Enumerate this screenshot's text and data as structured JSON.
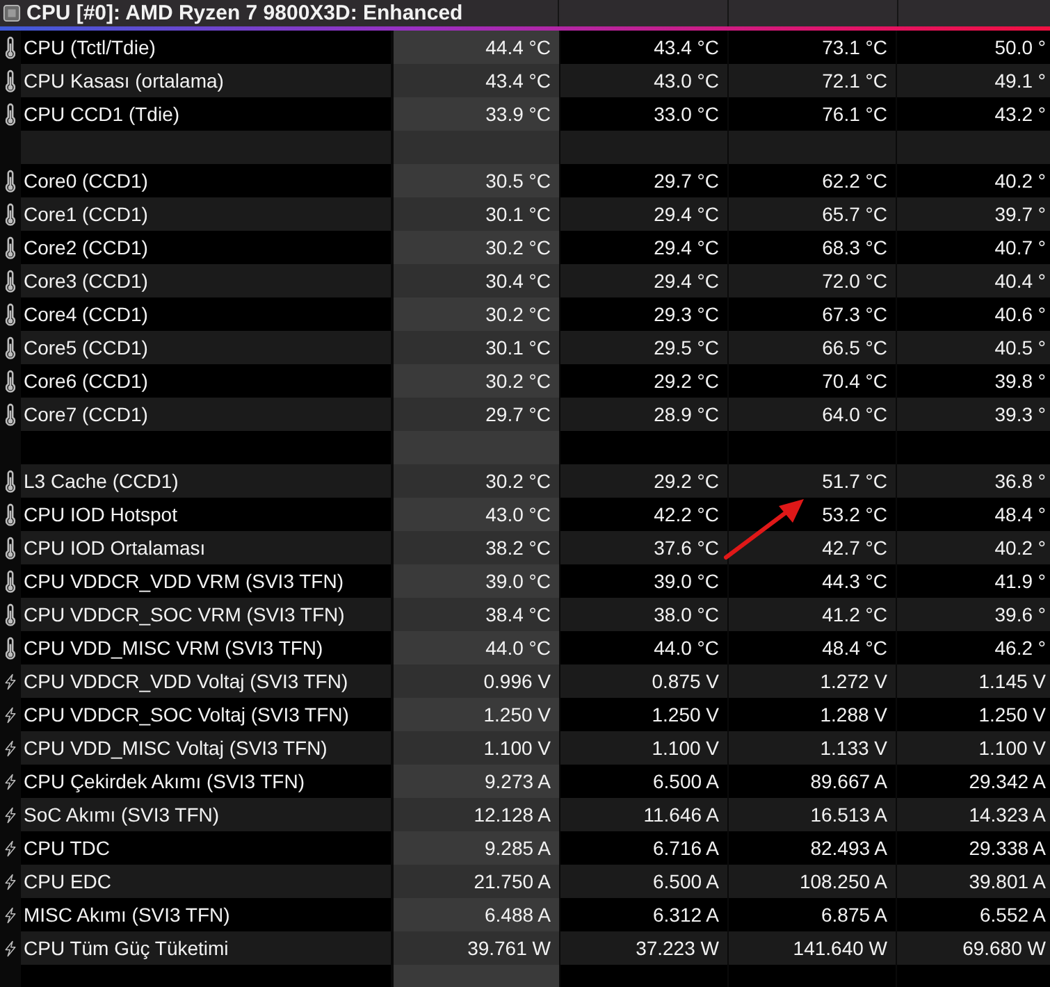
{
  "title": "CPU [#0]: AMD Ryzen 7 9800X3D: Enhanced",
  "rows": [
    {
      "kind": "temperature",
      "label": "CPU (Tctl/Tdie)",
      "values": [
        "44.4 °C",
        "43.4 °C",
        "73.1 °C",
        "50.0 °"
      ]
    },
    {
      "kind": "temperature",
      "label": "CPU Kasası (ortalama)",
      "values": [
        "43.4 °C",
        "43.0 °C",
        "72.1 °C",
        "49.1 °"
      ]
    },
    {
      "kind": "temperature",
      "label": "CPU CCD1 (Tdie)",
      "values": [
        "33.9 °C",
        "33.0 °C",
        "76.1 °C",
        "43.2 °"
      ]
    },
    {
      "kind": "spacer"
    },
    {
      "kind": "temperature",
      "label": "Core0 (CCD1)",
      "values": [
        "30.5 °C",
        "29.7 °C",
        "62.2 °C",
        "40.2 °"
      ]
    },
    {
      "kind": "temperature",
      "label": "Core1 (CCD1)",
      "values": [
        "30.1 °C",
        "29.4 °C",
        "65.7 °C",
        "39.7 °"
      ]
    },
    {
      "kind": "temperature",
      "label": "Core2 (CCD1)",
      "values": [
        "30.2 °C",
        "29.4 °C",
        "68.3 °C",
        "40.7 °"
      ]
    },
    {
      "kind": "temperature",
      "label": "Core3 (CCD1)",
      "values": [
        "30.4 °C",
        "29.4 °C",
        "72.0 °C",
        "40.4 °"
      ]
    },
    {
      "kind": "temperature",
      "label": "Core4 (CCD1)",
      "values": [
        "30.2 °C",
        "29.3 °C",
        "67.3 °C",
        "40.6 °"
      ]
    },
    {
      "kind": "temperature",
      "label": "Core5 (CCD1)",
      "values": [
        "30.1 °C",
        "29.5 °C",
        "66.5 °C",
        "40.5 °"
      ]
    },
    {
      "kind": "temperature",
      "label": "Core6 (CCD1)",
      "values": [
        "30.2 °C",
        "29.2 °C",
        "70.4 °C",
        "39.8 °"
      ]
    },
    {
      "kind": "temperature",
      "label": "Core7 (CCD1)",
      "values": [
        "29.7 °C",
        "28.9 °C",
        "64.0 °C",
        "39.3 °"
      ]
    },
    {
      "kind": "spacer"
    },
    {
      "kind": "temperature",
      "label": "L3 Cache (CCD1)",
      "values": [
        "30.2 °C",
        "29.2 °C",
        "51.7 °C",
        "36.8 °"
      ]
    },
    {
      "kind": "temperature",
      "label": "CPU IOD Hotspot",
      "values": [
        "43.0 °C",
        "42.2 °C",
        "53.2 °C",
        "48.4 °"
      ]
    },
    {
      "kind": "temperature",
      "label": "CPU IOD Ortalaması",
      "values": [
        "38.2 °C",
        "37.6 °C",
        "42.7 °C",
        "40.2 °"
      ]
    },
    {
      "kind": "temperature",
      "label": "CPU VDDCR_VDD VRM (SVI3 TFN)",
      "values": [
        "39.0 °C",
        "39.0 °C",
        "44.3 °C",
        "41.9 °"
      ]
    },
    {
      "kind": "temperature",
      "label": "CPU VDDCR_SOC VRM (SVI3 TFN)",
      "values": [
        "38.4 °C",
        "38.0 °C",
        "41.2 °C",
        "39.6 °"
      ]
    },
    {
      "kind": "temperature",
      "label": "CPU VDD_MISC VRM (SVI3 TFN)",
      "values": [
        "44.0 °C",
        "44.0 °C",
        "48.4 °C",
        "46.2 °"
      ]
    },
    {
      "kind": "electric",
      "label": "CPU VDDCR_VDD Voltaj (SVI3 TFN)",
      "values": [
        "0.996 V",
        "0.875 V",
        "1.272 V",
        "1.145 V"
      ]
    },
    {
      "kind": "electric",
      "label": "CPU VDDCR_SOC Voltaj (SVI3 TFN)",
      "values": [
        "1.250 V",
        "1.250 V",
        "1.288 V",
        "1.250 V"
      ]
    },
    {
      "kind": "electric",
      "label": "CPU VDD_MISC Voltaj (SVI3 TFN)",
      "values": [
        "1.100 V",
        "1.100 V",
        "1.133 V",
        "1.100 V"
      ]
    },
    {
      "kind": "electric",
      "label": "CPU Çekirdek Akımı (SVI3 TFN)",
      "values": [
        "9.273 A",
        "6.500 A",
        "89.667 A",
        "29.342 A"
      ]
    },
    {
      "kind": "electric",
      "label": "SoC Akımı (SVI3 TFN)",
      "values": [
        "12.128 A",
        "11.646 A",
        "16.513 A",
        "14.323 A"
      ]
    },
    {
      "kind": "electric",
      "label": "CPU TDC",
      "values": [
        "9.285 A",
        "6.716 A",
        "82.493 A",
        "29.338 A"
      ]
    },
    {
      "kind": "electric",
      "label": "CPU EDC",
      "values": [
        "21.750 A",
        "6.500 A",
        "108.250 A",
        "39.801 A"
      ]
    },
    {
      "kind": "electric",
      "label": "MISC Akımı (SVI3 TFN)",
      "values": [
        "6.488 A",
        "6.312 A",
        "6.875 A",
        "6.552 A"
      ]
    },
    {
      "kind": "electric",
      "label": "CPU Tüm Güç Tüketimi",
      "values": [
        "39.761 W",
        "37.223 W",
        "141.640 W",
        "69.680 W"
      ]
    },
    {
      "kind": "spacer"
    }
  ]
}
